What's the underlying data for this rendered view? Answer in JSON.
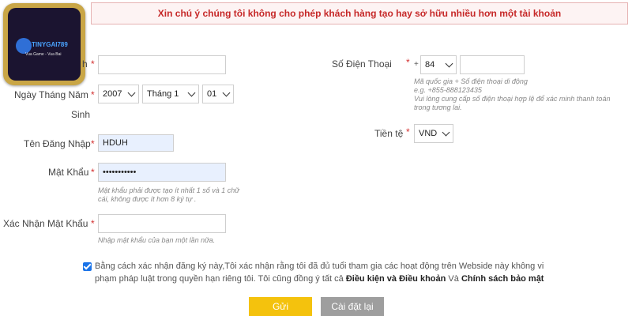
{
  "notice": "Xin chú ý chúng tôi không cho phép khách hàng tạo hay sở hữu nhiều hơn một tài khoản",
  "logo": {
    "name": "TINYGAI789",
    "tagline": "Vua Game - Vua Bai",
    "emblem_icon": "tiger-emblem-icon"
  },
  "form": {
    "name_label_fragment": "h",
    "required_mark": "*",
    "dob": {
      "label_line1": "Ngày Tháng Năm",
      "label_line2": "Sinh",
      "year": "2007",
      "month": "Tháng 1",
      "day": "01"
    },
    "username": {
      "label": "Tên Đăng Nhập",
      "value": "HDUH"
    },
    "password": {
      "label": "Mật Khẩu",
      "value": "•••••••••••",
      "hint": "Mật khẩu phải được tạo ít nhất 1 số và 1 chữ cái, không được ít hơn 8 ký tự ."
    },
    "confirm": {
      "label": "Xác Nhận Mật Khẩu",
      "hint": "Nhập mật khẩu của bạn một lần nữa."
    },
    "phone": {
      "label": "Số Điện Thoại",
      "plus": "+",
      "code": "84",
      "hint1": "Mã quốc gia + Số điện thoại di động",
      "hint2": "e.g. +855-888123435",
      "hint3": "Vui lòng cung cấp số điện thoại hợp lệ để xác minh thanh toán trong tương lai."
    },
    "currency": {
      "label": "Tiền tệ",
      "value": "VND"
    }
  },
  "agreement": {
    "text_line1": "Bằng cách xác nhận đăng ký này,Tôi xác nhận rằng tôi đã đủ tuổi tham gia các hoạt động trên Webside này không vi",
    "text_line2_pre": "phạm pháp luật trong quyền hạn riêng tôi. Tôi cũng đồng ý tất cả",
    "terms": "Điều kiện và Điều khoản",
    "connector": "Và",
    "privacy": "Chính sách bảo mật"
  },
  "buttons": {
    "submit": "Gửi",
    "reset": "Cài đặt lại"
  },
  "colors": {
    "submit": "#f4c20d",
    "reset": "#9e9e9e",
    "required": "#d32f2f",
    "notice_text": "#c62828"
  }
}
